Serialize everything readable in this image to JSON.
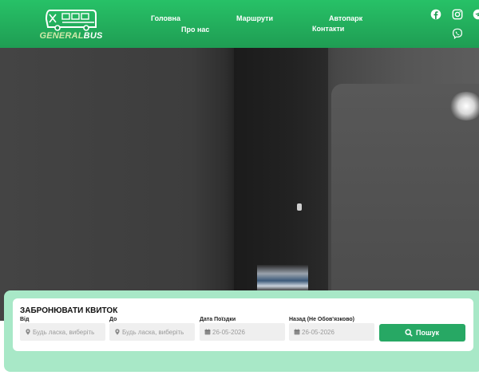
{
  "logo": {
    "text_general": "GENERAL",
    "text_bus": "BUS"
  },
  "nav": {
    "home": "Головна",
    "routes": "Маршрути",
    "fleet": "Автопарк",
    "about": "Про нас",
    "contacts": "Контакти"
  },
  "social": {
    "icons": [
      "facebook-icon",
      "instagram-icon",
      "telegram-icon",
      "viber-icon"
    ]
  },
  "booking": {
    "title": "ЗАБРОНЮВАТИ КВИТОК",
    "from_label": "Від",
    "from_placeholder": "Будь ласка, виберіть",
    "to_label": "До",
    "to_placeholder": "Будь ласка, виберіть",
    "date_label": "Дата Поїздки",
    "date_value": "26-05-2026",
    "return_label": "Назад (Не Обов'язково)",
    "return_value": "26-05-2026",
    "search_label": "Пошук"
  },
  "colors": {
    "brand_green": "#27c167",
    "button_green": "#27a864",
    "panel_bg": "#a8e8c7"
  }
}
